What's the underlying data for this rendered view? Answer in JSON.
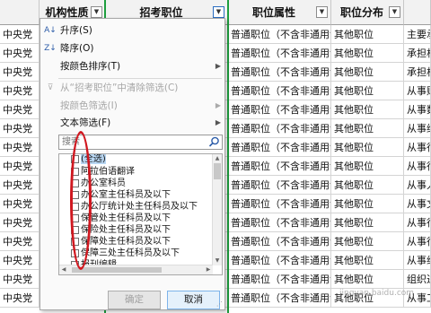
{
  "headers": {
    "col_b": "机构性质",
    "col_c": "招考职位",
    "col_d": "职位属性",
    "col_e": "职位分布",
    "filter_glyph": "▼"
  },
  "rows": [
    {
      "a": "中央党",
      "d": "普通职位（不含非通用语",
      "e": "其他职位",
      "f": "主要承"
    },
    {
      "a": "中央党",
      "d": "普通职位（不含非通用语",
      "e": "其他职位",
      "f": "承担机"
    },
    {
      "a": "中央党",
      "d": "普通职位（不含非通用语",
      "e": "其他职位",
      "f": "承担机"
    },
    {
      "a": "中央党",
      "d": "普通职位（不含非通用语",
      "e": "其他职位",
      "f": "从事财"
    },
    {
      "a": "中央党",
      "d": "普通职位（不含非通用语",
      "e": "其他职位",
      "f": "从事数"
    },
    {
      "a": "中央党",
      "d": "普通职位（不含非通用语",
      "e": "其他职位",
      "f": "从事综"
    },
    {
      "a": "中央党",
      "d": "普通职位（不含非通用语",
      "e": "其他职位",
      "f": "从事行"
    },
    {
      "a": "中央党",
      "d": "普通职位（不含非通用语",
      "e": "其他职位",
      "f": "从事行"
    },
    {
      "a": "中央党",
      "d": "普通职位（不含非通用语",
      "e": "其他职位",
      "f": "从事人"
    },
    {
      "a": "中央党",
      "d": "普通职位（不含非通用语",
      "e": "其他职位",
      "f": "从事文"
    },
    {
      "a": "中央党",
      "d": "普通职位（不含非通用语",
      "e": "其他职位",
      "f": "从事行"
    },
    {
      "a": "中央党",
      "d": "普通职位（不含非通用语",
      "e": "其他职位",
      "f": "从事行"
    },
    {
      "a": "中央党",
      "d": "普通职位（不含非通用语",
      "e": "其他职位",
      "f": "从事组"
    },
    {
      "a": "中央党",
      "d": "普通职位（不含非通用语",
      "e": "其他职位",
      "f": "组织进"
    },
    {
      "a": "中央党",
      "d": "普通职位（不含非通用语",
      "e": "其他职位",
      "f": "从事工"
    }
  ],
  "menu": {
    "sort_asc": "升序(S)",
    "sort_desc": "降序(O)",
    "sort_by_color": "按颜色排序(T)",
    "clear_filter": "从“招考职位”中清除筛选(C)",
    "filter_by_color": "按颜色筛选(I)",
    "text_filter": "文本筛选(F)",
    "search_placeholder": "搜索",
    "submenu_arrow": "▶",
    "items": [
      "(全选)",
      "阿拉伯语翻译",
      "办公室科员",
      "办公室主任科员及以下",
      "办公厅统计处主任科员及以下",
      "保管处主任科员及以下",
      "保险处主任科员及以下",
      "保障处主任科员及以下",
      "保障三处主任科员及以下",
      "报刊编辑"
    ],
    "ok": "确定",
    "cancel": "取消"
  },
  "icons": {
    "sort_asc": "sort-ascending-icon",
    "sort_desc": "sort-descending-icon",
    "clear_filter": "clear-filter-icon",
    "search": "search-icon"
  },
  "watermark": "jingyan.baidu.com",
  "colors": {
    "selection": "#1e9e3e",
    "annotation": "#d01820",
    "list_highlight": "#b9d7f3"
  }
}
